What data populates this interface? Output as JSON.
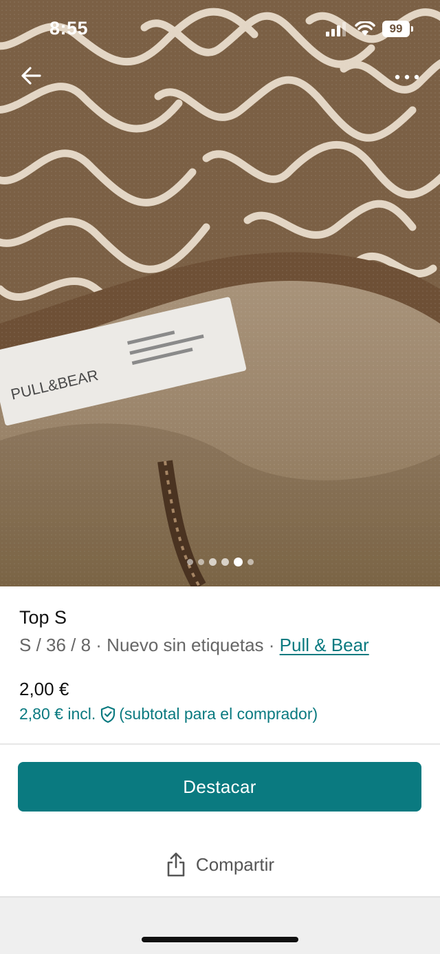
{
  "status_bar": {
    "time": "8:55",
    "battery": "99",
    "icons": [
      "cellular-signal-icon",
      "wifi-icon",
      "battery-icon"
    ]
  },
  "nav": {
    "back_icon": "arrow-left-icon",
    "more_icon": "more-horizontal-icon"
  },
  "photo": {
    "label_text": "PULL&BEAR",
    "carousel": {
      "total": 6,
      "active_index": 5
    }
  },
  "item": {
    "title": "Top S",
    "meta_prefix": "S / 36 / 8 · Nuevo sin etiquetas · ",
    "brand": "Pull & Bear",
    "price": "2,00 €",
    "total_price": "2,80 € incl.",
    "total_note": "(subtotal para el comprador)"
  },
  "actions": {
    "primary": "Destacar",
    "share": "Compartir"
  },
  "colors": {
    "accent": "#0a7a80",
    "text": "#111111",
    "muted": "#666666"
  }
}
